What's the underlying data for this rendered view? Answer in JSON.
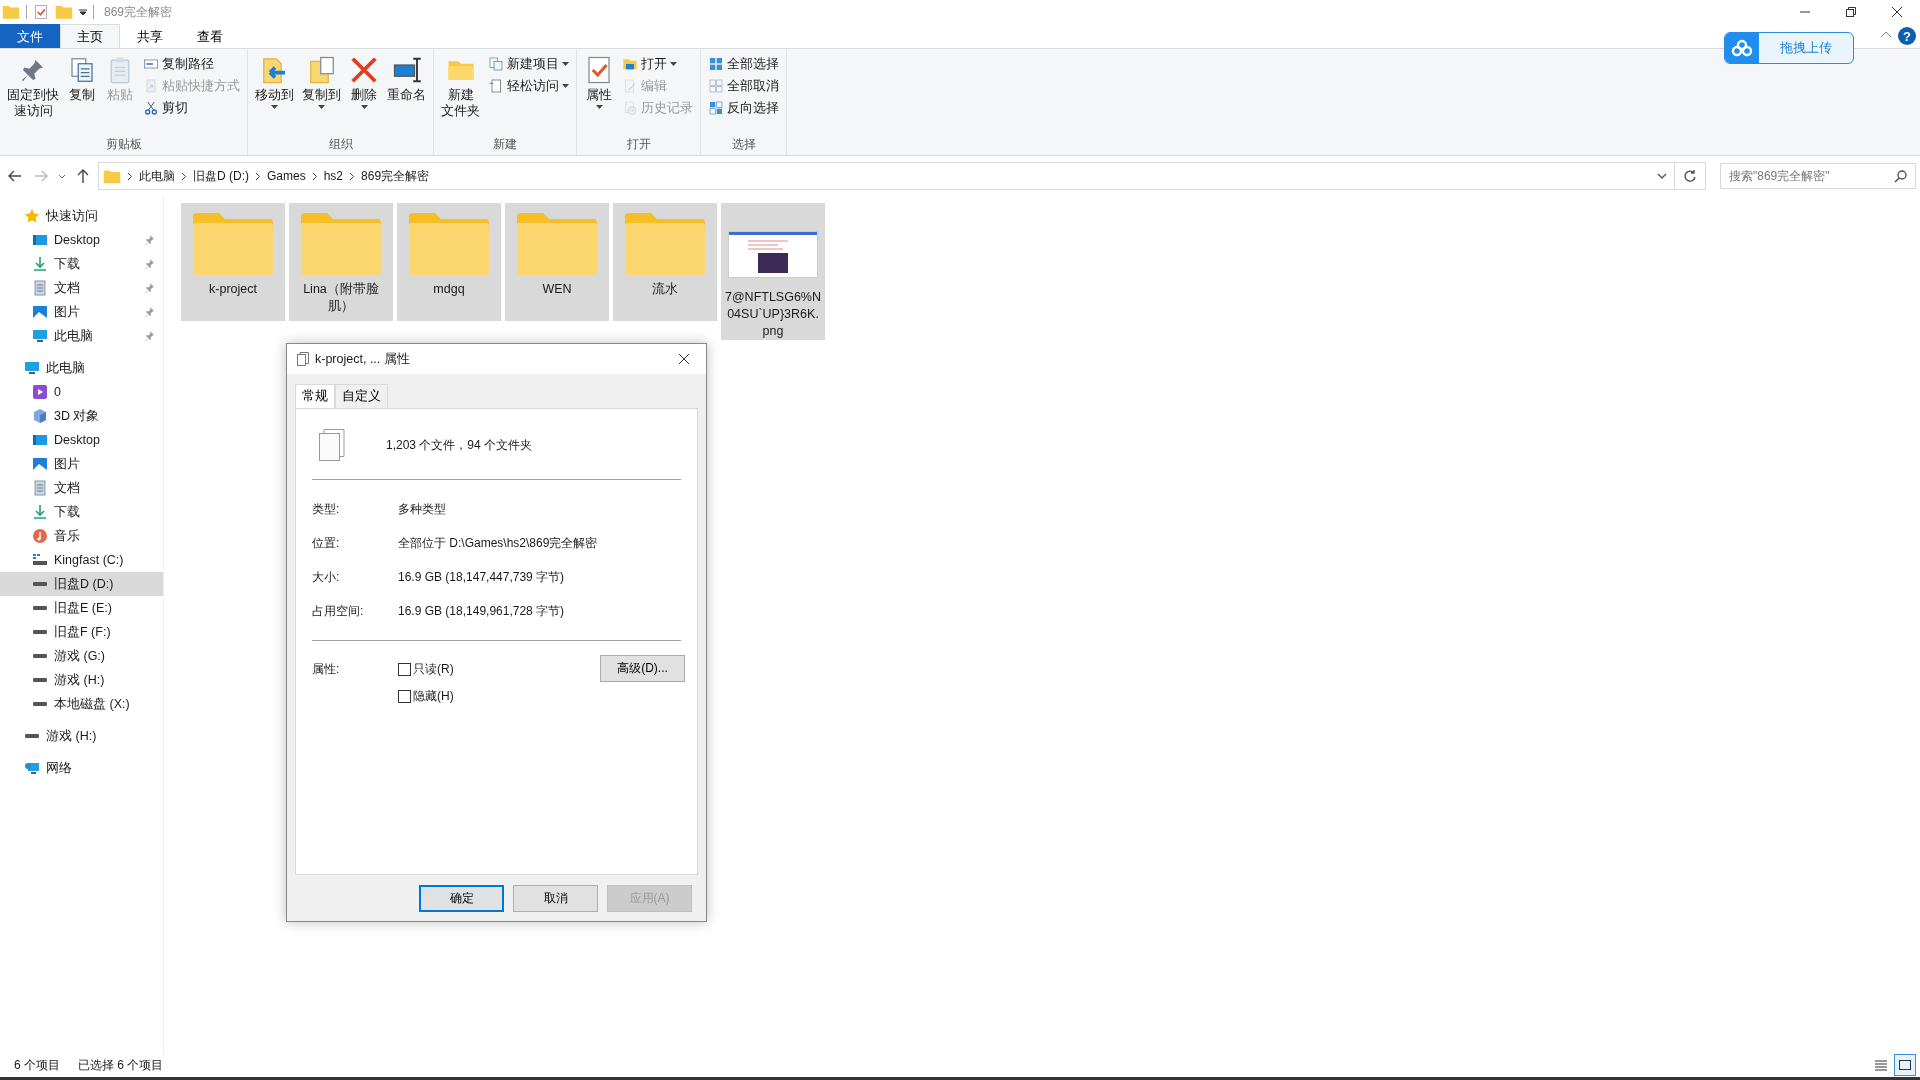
{
  "title_bar": {
    "title": "869完全解密"
  },
  "ribbon_tabs": [
    {
      "label": "文件",
      "kind": "file",
      "selected": false
    },
    {
      "label": "主页",
      "kind": "tab",
      "selected": true
    },
    {
      "label": "共享",
      "kind": "tab",
      "selected": false
    },
    {
      "label": "查看",
      "kind": "tab",
      "selected": false
    }
  ],
  "upload_button": {
    "label": "拖拽上传"
  },
  "help": "?",
  "ribbon_groups": [
    {
      "label": "剪贴板",
      "items": [
        {
          "lines": [
            "固定到快",
            "速访问"
          ],
          "kind": "large",
          "disabled": false,
          "dropdown": false
        },
        {
          "lines": [
            "复制"
          ],
          "kind": "large",
          "disabled": false,
          "dropdown": false
        },
        {
          "lines": [
            "粘贴"
          ],
          "kind": "large",
          "disabled": true,
          "dropdown": false
        },
        {
          "label": "复制路径",
          "kind": "small",
          "disabled": false,
          "dropdown": false
        },
        {
          "label": "粘贴快捷方式",
          "kind": "small",
          "disabled": true,
          "dropdown": false
        },
        {
          "label": "剪切",
          "kind": "small",
          "disabled": false,
          "dropdown": false
        }
      ]
    },
    {
      "label": "组织",
      "items": [
        {
          "lines": [
            "移动到"
          ],
          "kind": "large",
          "disabled": false,
          "dropdown": true
        },
        {
          "lines": [
            "复制到"
          ],
          "kind": "large",
          "disabled": false,
          "dropdown": true
        },
        {
          "lines": [
            "删除"
          ],
          "kind": "large",
          "disabled": false,
          "dropdown": true
        },
        {
          "lines": [
            "重命名"
          ],
          "kind": "large",
          "disabled": false,
          "dropdown": false
        }
      ]
    },
    {
      "label": "新建",
      "items": [
        {
          "lines": [
            "新建",
            "文件夹"
          ],
          "kind": "large",
          "disabled": false,
          "dropdown": false
        },
        {
          "label": "新建项目",
          "kind": "small",
          "disabled": false,
          "dropdown": true
        },
        {
          "label": "轻松访问",
          "kind": "small",
          "disabled": false,
          "dropdown": true
        }
      ]
    },
    {
      "label": "打开",
      "items": [
        {
          "lines": [
            "属性"
          ],
          "kind": "large",
          "disabled": false,
          "dropdown": true
        },
        {
          "label": "打开",
          "kind": "small",
          "disabled": false,
          "dropdown": true
        },
        {
          "label": "编辑",
          "kind": "small",
          "disabled": true,
          "dropdown": false
        },
        {
          "label": "历史记录",
          "kind": "small",
          "disabled": true,
          "dropdown": false
        }
      ]
    },
    {
      "label": "选择",
      "items": [
        {
          "label": "全部选择",
          "kind": "small",
          "disabled": false,
          "dropdown": false
        },
        {
          "label": "全部取消",
          "kind": "small",
          "disabled": false,
          "dropdown": false
        },
        {
          "label": "反向选择",
          "kind": "small",
          "disabled": false,
          "dropdown": false
        }
      ]
    }
  ],
  "address_bar": {
    "path": [
      "此电脑",
      "旧盘D (D:)",
      "Games",
      "hs2",
      "869完全解密"
    ]
  },
  "search": {
    "placeholder": "搜索\"869完全解密\""
  },
  "sidebar": [
    {
      "label": "快速访问",
      "kind": "star",
      "selected": false,
      "children": [
        {
          "label": "Desktop",
          "kind": "desktop",
          "pinned": true,
          "selected": false
        },
        {
          "label": "下载",
          "kind": "download",
          "pinned": true,
          "selected": false
        },
        {
          "label": "文档",
          "kind": "document",
          "pinned": true,
          "selected": false
        },
        {
          "label": "图片",
          "kind": "picture",
          "pinned": true,
          "selected": false
        },
        {
          "label": "此电脑",
          "kind": "computer",
          "pinned": true,
          "selected": false
        }
      ]
    },
    {
      "label": "此电脑",
      "kind": "computer",
      "selected": false,
      "children": [
        {
          "label": "0",
          "kind": "video",
          "pinned": false,
          "selected": false
        },
        {
          "label": "3D 对象",
          "kind": "cube",
          "pinned": false,
          "selected": false
        },
        {
          "label": "Desktop",
          "kind": "desktop",
          "pinned": false,
          "selected": false
        },
        {
          "label": "图片",
          "kind": "picture",
          "pinned": false,
          "selected": false
        },
        {
          "label": "文档",
          "kind": "document",
          "pinned": false,
          "selected": false
        },
        {
          "label": "下载",
          "kind": "download",
          "pinned": false,
          "selected": false
        },
        {
          "label": "音乐",
          "kind": "music",
          "pinned": false,
          "selected": false
        },
        {
          "label": "Kingfast (C:)",
          "kind": "system-drive",
          "pinned": false,
          "selected": false
        },
        {
          "label": "旧盘D (D:)",
          "kind": "drive",
          "pinned": false,
          "selected": true
        },
        {
          "label": "旧盘E (E:)",
          "kind": "drive",
          "pinned": false,
          "selected": false
        },
        {
          "label": "旧盘F (F:)",
          "kind": "drive",
          "pinned": false,
          "selected": false
        },
        {
          "label": "游戏 (G:)",
          "kind": "drive",
          "pinned": false,
          "selected": false
        },
        {
          "label": "游戏 (H:)",
          "kind": "drive",
          "pinned": false,
          "selected": false
        },
        {
          "label": "本地磁盘 (X:)",
          "kind": "drive",
          "pinned": false,
          "selected": false
        }
      ]
    },
    {
      "label": "游戏 (H:)",
      "kind": "drive",
      "selected": false
    },
    {
      "label": "网络",
      "kind": "network",
      "selected": false
    }
  ],
  "files": [
    {
      "name": "k-project",
      "kind": "folder",
      "selected": true
    },
    {
      "name": "Lina（附带脸肌）",
      "kind": "folder",
      "selected": true
    },
    {
      "name": "mdgq",
      "kind": "folder",
      "selected": true
    },
    {
      "name": "WEN",
      "kind": "folder",
      "selected": true
    },
    {
      "name": "流水",
      "kind": "folder",
      "selected": true
    },
    {
      "name": "7@NFTLSG6%N04SU`UP}3R6K.png",
      "kind": "image",
      "selected": true
    }
  ],
  "dialog": {
    "title": "k-project, ... 属性",
    "tabs": [
      {
        "label": "常规",
        "selected": true
      },
      {
        "label": "自定义",
        "selected": false
      }
    ],
    "summary": "1,203 个文件，94 个文件夹",
    "properties": [
      {
        "label": "类型:",
        "value": "多种类型"
      },
      {
        "label": "位置:",
        "value": "全部位于 D:\\Games\\hs2\\869完全解密"
      },
      {
        "label": "大小:",
        "value": "16.9 GB (18,147,447,739 字节)"
      },
      {
        "label": "占用空间:",
        "value": "16.9 GB (18,149,961,728 字节)"
      }
    ],
    "attributes_label": "属性:",
    "attributes": [
      {
        "label": "只读(R)",
        "checked": false
      },
      {
        "label": "隐藏(H)",
        "checked": false
      }
    ],
    "advanced_button": "高级(D)...",
    "buttons": [
      {
        "label": "确定",
        "kind": "default",
        "disabled": false
      },
      {
        "label": "取消",
        "kind": "normal",
        "disabled": false
      },
      {
        "label": "应用(A)",
        "kind": "normal",
        "disabled": true
      }
    ]
  },
  "status_bar": {
    "item_count": "6 个项目",
    "selection": "已选择 6 个项目"
  },
  "view_buttons": [
    {
      "kind": "details",
      "selected": false
    },
    {
      "kind": "large-icons",
      "selected": true
    }
  ]
}
